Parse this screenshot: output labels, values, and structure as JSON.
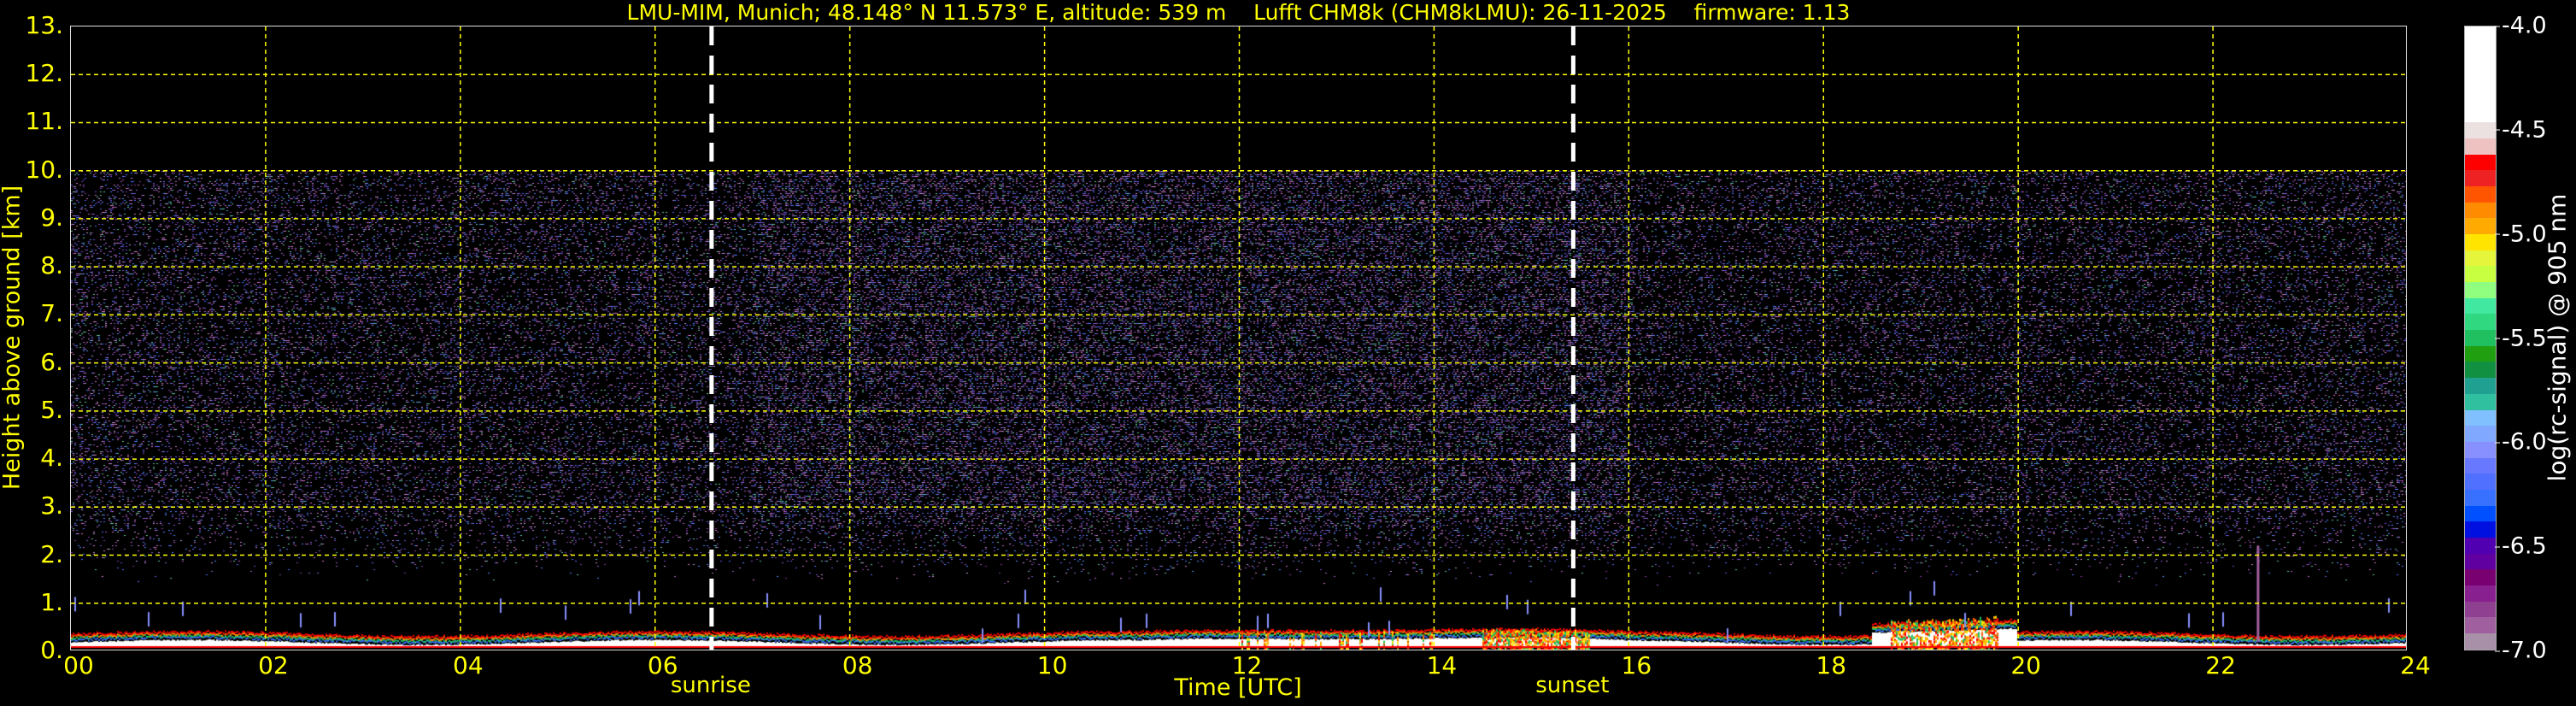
{
  "chart_data": {
    "type": "heatmap",
    "title": "LMU-MIM, Munich; 48.148° N 11.573° E, altitude: 539 m    Lufft CHM8k (CHM8kLMU): 26-11-2025    firmware: 1.13",
    "xlabel": "Time [UTC]",
    "ylabel": "Height above ground [km]",
    "xlim": [
      0,
      24
    ],
    "ylim": [
      0,
      13
    ],
    "x_ticks": [
      "00",
      "02",
      "04",
      "06",
      "08",
      "10",
      "12",
      "14",
      "16",
      "18",
      "20",
      "22",
      "24"
    ],
    "y_ticks": [
      "0.",
      "1.",
      "2.",
      "3.",
      "4.",
      "5.",
      "6.",
      "7.",
      "8.",
      "9.",
      "10.",
      "11.",
      "12.",
      "13."
    ],
    "grid": true,
    "events": [
      {
        "label": "sunrise",
        "hour": 6.58
      },
      {
        "label": "sunset",
        "hour": 15.43
      }
    ],
    "measurement_top_km": 10,
    "colorbar": {
      "label": "log(rc-signal) @ 905 nm",
      "range": [
        -7.0,
        -4.0
      ],
      "ticks": [
        "-4.0",
        "-4.5",
        "-5.0",
        "-5.5",
        "-6.0",
        "-6.5",
        "-7.0"
      ],
      "colors": [
        "#ffffff",
        "#ffffff",
        "#ffffff",
        "#ffffff",
        "#ffffff",
        "#ffffff",
        "#ebe1e1",
        "#efc2c2",
        "#ff0000",
        "#ee2222",
        "#ff5500",
        "#ff8c00",
        "#ffaa00",
        "#ffe400",
        "#e4f53c",
        "#c8ff40",
        "#90ff80",
        "#40e8a0",
        "#30d880",
        "#20c060",
        "#20a010",
        "#109040",
        "#20a090",
        "#30c0a0",
        "#80c0ff",
        "#80a8ff",
        "#8890ff",
        "#6878ff",
        "#5070ff",
        "#3870ff",
        "#0050ff",
        "#0010e0",
        "#5000b0",
        "#6000a0",
        "#780070",
        "#882090",
        "#904090",
        "#a060a0",
        "#a890a8"
      ]
    }
  }
}
